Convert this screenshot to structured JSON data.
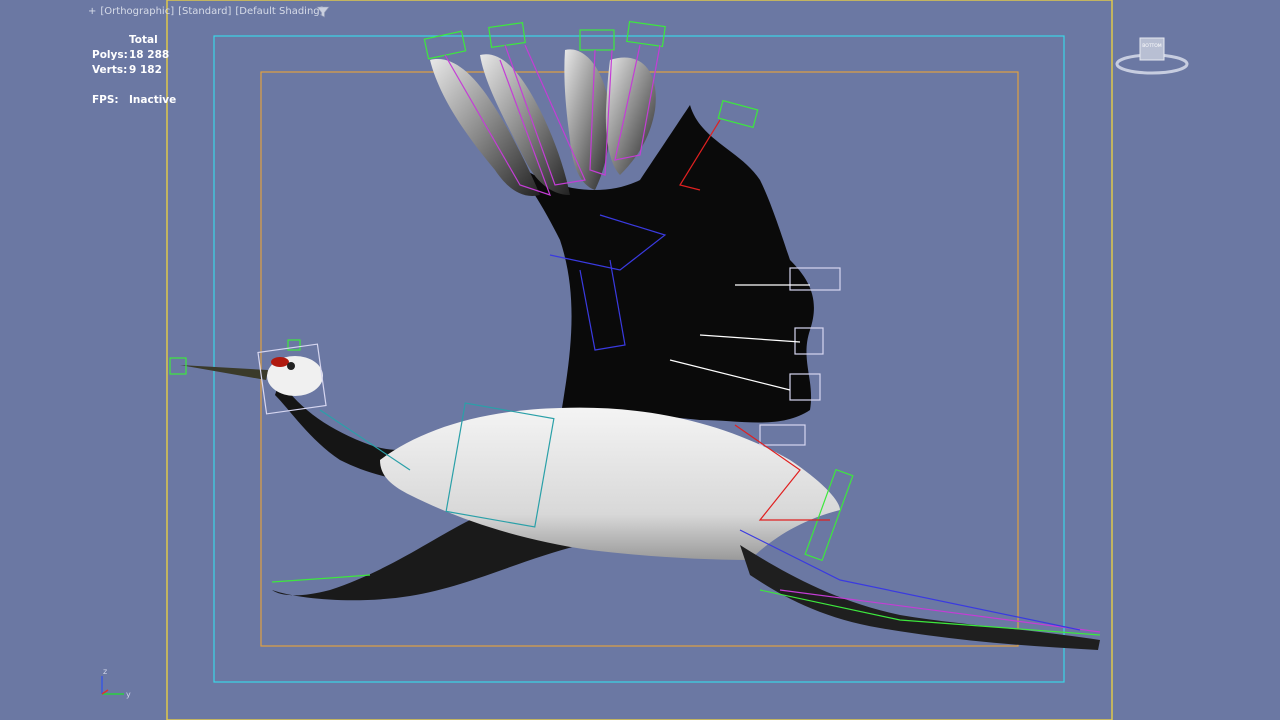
{
  "viewport": {
    "labels": [
      "+",
      "[Orthographic]",
      "[Standard]",
      "[Default Shading]"
    ],
    "filter_icon": "funnel-icon"
  },
  "stats": {
    "total_label": "Total",
    "polys_label": "Polys:",
    "polys_value": "18 288",
    "verts_label": "Verts:",
    "verts_value": "9 182",
    "fps_label": "FPS:",
    "fps_value": "Inactive"
  },
  "viewcube": {
    "face_label": "BOTTOM",
    "icon": "viewcube-icon"
  },
  "axis_tripod": {
    "z_label": "z",
    "y_label": "y"
  },
  "colors": {
    "background": "#6b78a3",
    "safe_frame_outer": "#e0c84a",
    "safe_frame_action": "#3ad6e8",
    "safe_frame_title": "#e0a040"
  }
}
